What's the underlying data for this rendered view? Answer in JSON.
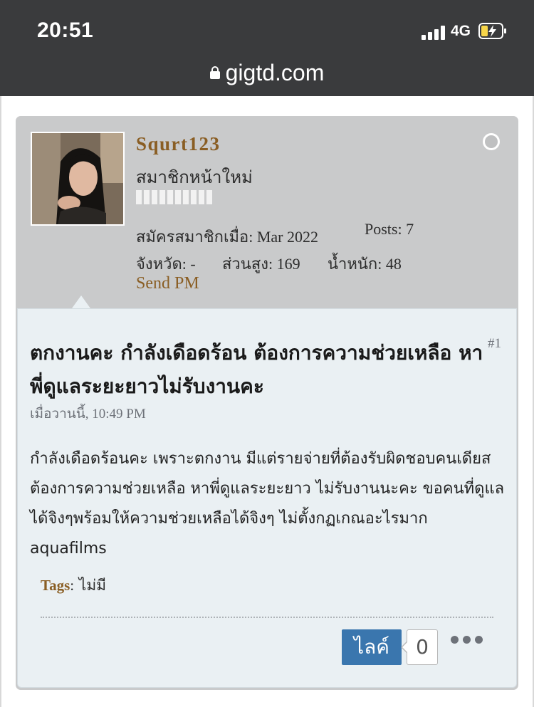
{
  "status_bar": {
    "time": "20:51",
    "network": "4G",
    "icons": [
      "signal-icon",
      "battery-charging-icon"
    ]
  },
  "browser": {
    "url": "gigtd.com"
  },
  "user": {
    "username": "Squrt123",
    "title": "สมาชิกหน้าใหม่",
    "joined_label": "สมัครสมาชิกเมื่อ",
    "joined_value": "Mar 2022",
    "posts_label": "Posts",
    "posts_value": "7",
    "province_label": "จังหวัด",
    "province_value": "-",
    "height_label": "ส่วนสูง",
    "height_value": "169",
    "weight_label": "น้ำหนัก",
    "weight_value": "48",
    "send_pm": "Send PM"
  },
  "post": {
    "number": "#1",
    "title": "ตกงานคะ กำลังเดือดร้อน ต้องการความช่วยเหลือ หาพี่ดูแลระยะยาวไม่รับงานคะ",
    "date": "เมื่อวานนี้, 10:49 PM",
    "body": "กำลังเดือดร้อนคะ เพราะตกงาน มีแต่รายจ่ายที่ต้องรับผิดชอบคนเดียส ต้องการความช่วยเหลือ หาพี่ดูแลระยะยาว ไม่รับงานนะคะ ขอคนที่ดูแลได้จิงๆพร้อมให้ความช่วยเหลือได้จิงๆ ไม่ตั้งกฏเกณอะไรมาก aquafilms",
    "tags_label": "Tags",
    "tags_value": "ไม่มี",
    "like_label": "ไลค์",
    "like_count": "0"
  },
  "colors": {
    "accent": "#8a5e24",
    "like_button": "#3a76ae",
    "post_bg": "#eaf0f3",
    "header_bg": "#c9cacb"
  }
}
